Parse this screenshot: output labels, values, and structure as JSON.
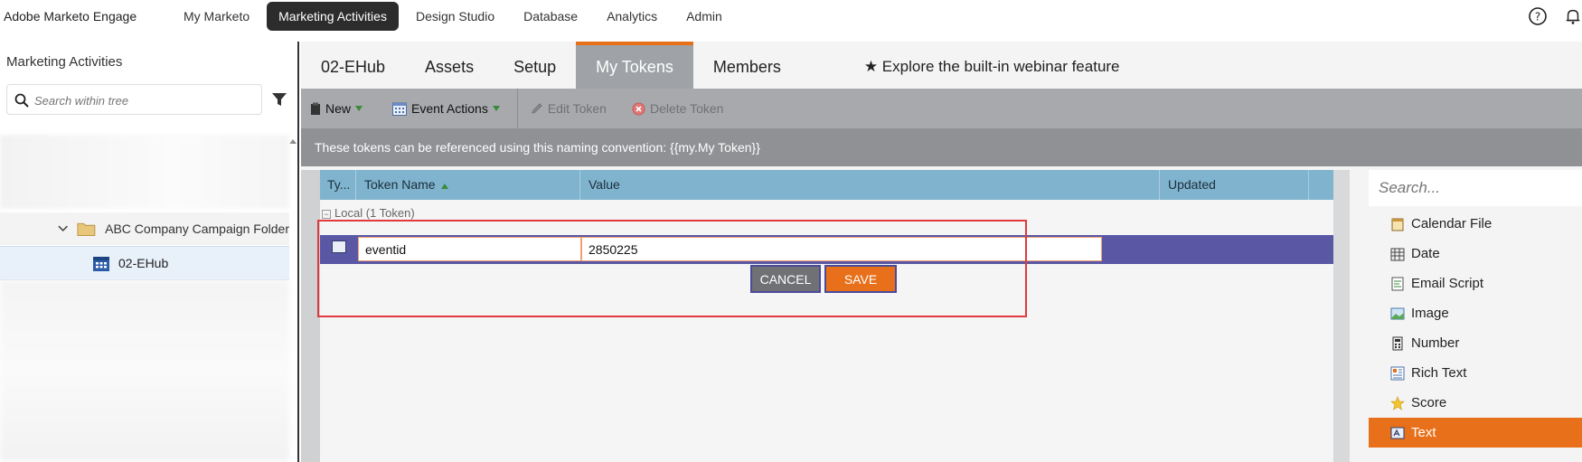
{
  "app": {
    "brand": "Adobe Marketo Engage"
  },
  "topnav": {
    "items": [
      "My Marketo",
      "Marketing Activities",
      "Design Studio",
      "Database",
      "Analytics",
      "Admin"
    ],
    "active_index": 1
  },
  "sidebar": {
    "title": "Marketing Activities",
    "search_placeholder": "Search within tree",
    "folder_label": "ABC Company Campaign Folder",
    "program_label": "02-EHub"
  },
  "tabs": {
    "items": [
      "02-EHub",
      "Assets",
      "Setup",
      "My Tokens",
      "Members"
    ],
    "active_index": 3,
    "explore": "★ Explore the built-in webinar feature"
  },
  "toolbar": {
    "new_label": "New",
    "event_actions_label": "Event Actions",
    "edit_token_label": "Edit Token",
    "delete_token_label": "Delete Token"
  },
  "infobar": {
    "text": "These tokens can be referenced using this naming convention: {{my.My Token}}"
  },
  "grid": {
    "headers": {
      "type": "Ty...",
      "token_name": "Token Name",
      "value": "Value",
      "updated": "Updated"
    },
    "group_label": "Local (1 Token)",
    "row": {
      "token_name": "eventid",
      "value": "2850225"
    },
    "cancel_label": "CANCEL",
    "save_label": "SAVE"
  },
  "token_types": {
    "search_placeholder": "Search...",
    "items": [
      "Calendar File",
      "Date",
      "Email Script",
      "Image",
      "Number",
      "Rich Text",
      "Score",
      "Text"
    ],
    "active_index": 7
  },
  "colors": {
    "accent": "#e8701a",
    "nav_active": "#2c2c2c",
    "grid_header": "#7fb3ce",
    "row_edit": "#5a57a5",
    "highlight_box": "#e0393e"
  }
}
